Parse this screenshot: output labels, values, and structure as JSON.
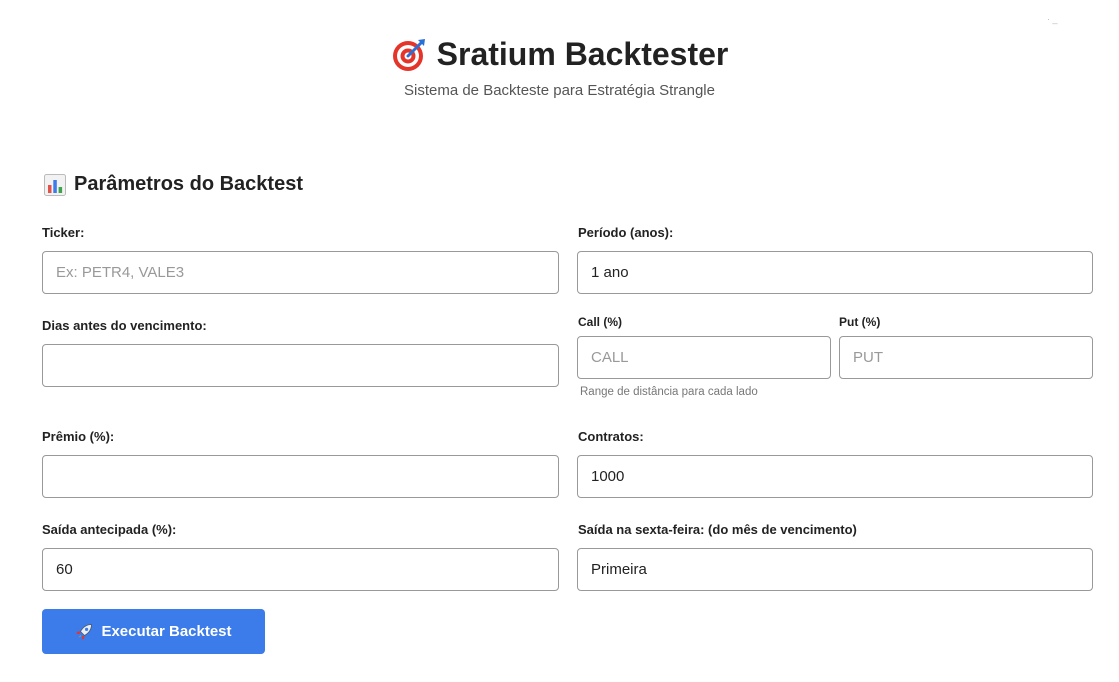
{
  "app": {
    "title": "Sratium Backtester",
    "subtitle": "Sistema de Backteste para Estratégia Strangle",
    "corner_mark": "· _"
  },
  "section": {
    "title": "Parâmetros do Backtest"
  },
  "fields": {
    "ticker": {
      "label": "Ticker:",
      "value": "",
      "placeholder": "Ex: PETR4, VALE3"
    },
    "periodo": {
      "label": "Período (anos):",
      "value": "1 ano"
    },
    "dias": {
      "label": "Dias antes do vencimento:",
      "value": ""
    },
    "call": {
      "label": "Call (%)",
      "value": "",
      "placeholder": "CALL"
    },
    "put": {
      "label": "Put (%)",
      "value": "",
      "placeholder": "PUT"
    },
    "range_hint": "Range de distância para cada lado",
    "premio": {
      "label": "Prêmio (%):",
      "value": ""
    },
    "contratos": {
      "label": "Contratos:",
      "value": "1000"
    },
    "saida_antecipada": {
      "label": "Saída antecipada (%):",
      "value": "60"
    },
    "saida_sexta": {
      "label": "Saída na sexta-feira: (do mês de vencimento)",
      "value": "Primeira"
    }
  },
  "actions": {
    "run_label": "Executar Backtest"
  },
  "icons": {
    "title": "target-icon",
    "section": "bar-chart-icon",
    "run": "rocket-icon"
  },
  "colors": {
    "accent": "#3b7bea",
    "target_red": "#e5352b",
    "dart_blue": "#2a6fd6"
  }
}
